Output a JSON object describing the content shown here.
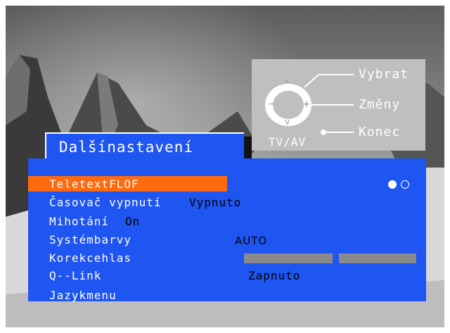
{
  "remote_hints": {
    "select": "Vybrat",
    "change": "Změny",
    "exit": "Konec",
    "source_key": "TV/AV",
    "up_glyph": "^",
    "down_glyph": "v",
    "minus_glyph": "−",
    "plus_glyph": "+"
  },
  "menu": {
    "title": "Dalšínastavení",
    "items": [
      {
        "label": "TeletextFLOF",
        "value": "",
        "selected": true,
        "toggle_state": "on"
      },
      {
        "label": "Časovač vypnutí",
        "value": "Vypnuto"
      },
      {
        "label": "Mihotání",
        "value": "On"
      },
      {
        "label": "Systémbarvy",
        "value": "AUTO"
      },
      {
        "label": "Korekcehlas",
        "value": ""
      },
      {
        "label": "Q--Link",
        "value": "Zapnuto"
      },
      {
        "label": "Jazykmenu",
        "value": ""
      }
    ]
  },
  "colors": {
    "menu_blue": "#1f55f0",
    "highlight_orange": "#ff6a0f",
    "hint_panel_gray": "#bfbfbf"
  }
}
